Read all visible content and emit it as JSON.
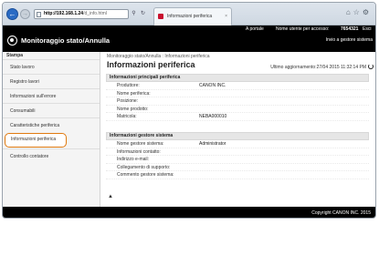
{
  "browser": {
    "address_host": "http://192.168.1.24",
    "address_path": "/d_info.html",
    "tab_label": "Informazioni periferica"
  },
  "topbar": {
    "portal_link": "A portale",
    "user_label": "Nome utente per accesso:",
    "user_value": "7654321",
    "logout_link": "Esci"
  },
  "header": {
    "app_title": "Monitoraggio stato/Annulla",
    "invio_link": "Invio a gestore sistema"
  },
  "sidebar": {
    "heading": "Stampa",
    "items": [
      {
        "label": "Stato lavoro"
      },
      {
        "label": "Registro lavori"
      },
      {
        "label": "Informazioni sull'errore"
      },
      {
        "label": "Consumabili"
      },
      {
        "label": "Caratteristiche periferica"
      },
      {
        "label": "Informazioni periferica"
      },
      {
        "label": "Controllo contatore"
      }
    ]
  },
  "main": {
    "breadcrumb": "Monitoraggio stato/Annulla : Informazioni periferica",
    "title": "Informazioni periferica",
    "last_update": "Ultimo aggiornamento:27/04 2015 11:32:14 PM",
    "section1": {
      "title": "Informazioni principali periferica",
      "rows": [
        {
          "label": "Produttore:",
          "value": "CANON INC."
        },
        {
          "label": "Nome periferica:",
          "value": ""
        },
        {
          "label": "Posizione:",
          "value": ""
        },
        {
          "label": "Nome prodotto:",
          "value": ""
        },
        {
          "label": "Matricola:",
          "value": "NEBA000010"
        }
      ]
    },
    "section2": {
      "title": "Informazioni gestore sistema",
      "rows": [
        {
          "label": "Nome gestore sistema:",
          "value": "Administrator"
        },
        {
          "label": "Informazioni contatto:",
          "value": ""
        },
        {
          "label": "Indirizzo e-mail:",
          "value": ""
        },
        {
          "label": "Collegamento di supporto:",
          "value": ""
        },
        {
          "label": "Commento gestore sistema:",
          "value": ""
        }
      ]
    }
  },
  "footer": {
    "copyright": "Copyright CANON INC. 2015"
  },
  "icons": {
    "back": "back-arrow-icon",
    "forward": "forward-arrow-icon",
    "refresh": "refresh-icon",
    "logo": "monitor-logo-icon",
    "page_top": "page-top-arrow-icon"
  }
}
